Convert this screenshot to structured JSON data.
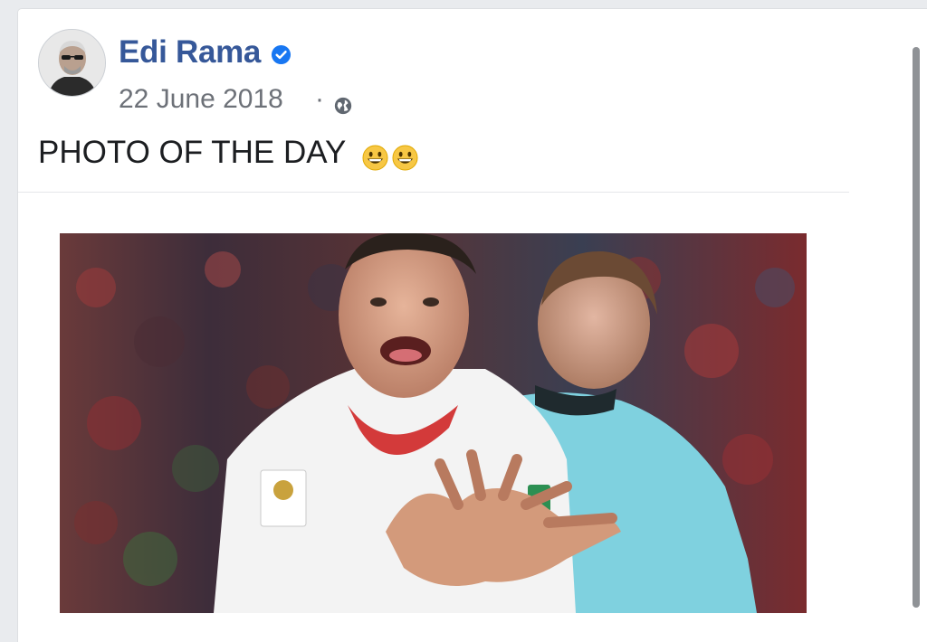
{
  "post": {
    "author_name": "Edi Rama",
    "verified_icon": "verified-badge-icon",
    "date": "22 June 2018",
    "separator": "·",
    "privacy_icon": "globe-icon",
    "text": "PHOTO OF THE DAY",
    "emojis": [
      "grinning-face-emoji",
      "grinning-face-emoji"
    ],
    "photo_description": "football-player-celebration-photo"
  },
  "colors": {
    "author": "#365899",
    "meta": "#6d7178",
    "text": "#1c1e21",
    "verified": "#1877f2"
  }
}
